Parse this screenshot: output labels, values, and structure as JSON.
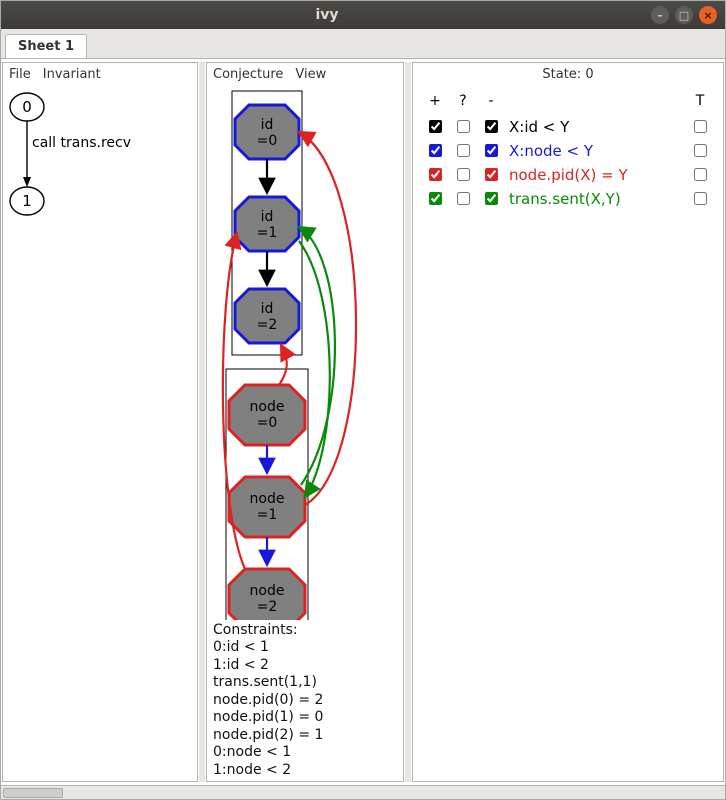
{
  "window": {
    "title": "ivy"
  },
  "tabs": {
    "sheet1": {
      "label": "Sheet 1"
    }
  },
  "left": {
    "menu": {
      "file": "File",
      "invariant": "Invariant"
    },
    "node0": "0",
    "edge_label": "call trans.recv",
    "node1": "1"
  },
  "middle": {
    "menu": {
      "conjecture": "Conjecture",
      "view": "View"
    },
    "ids": [
      {
        "label1": "id",
        "label2": "=0"
      },
      {
        "label1": "id",
        "label2": "=1"
      },
      {
        "label1": "id",
        "label2": "=2"
      }
    ],
    "nodes": [
      {
        "label1": "node",
        "label2": "=0"
      },
      {
        "label1": "node",
        "label2": "=1"
      },
      {
        "label1": "node",
        "label2": "=2"
      }
    ],
    "constraints_header": "Constraints:",
    "constraints": [
      "0:id < 1",
      "1:id < 2",
      "trans.sent(1,1)",
      "node.pid(0) = 2",
      "node.pid(1) = 0",
      "node.pid(2) = 1",
      "0:node < 1",
      "1:node < 2"
    ]
  },
  "right": {
    "state_label": "State: 0",
    "head": {
      "plus": "+",
      "q": "?",
      "minus": "-",
      "T": "T"
    },
    "rows": [
      {
        "cls": "black",
        "plus": true,
        "q": false,
        "minus": true,
        "label": "X:id < Y",
        "t": false
      },
      {
        "cls": "blue",
        "plus": true,
        "q": false,
        "minus": true,
        "label": "X:node < Y",
        "t": false
      },
      {
        "cls": "red",
        "plus": true,
        "q": false,
        "minus": true,
        "label": "node.pid(X) = Y",
        "t": false
      },
      {
        "cls": "green",
        "plus": true,
        "q": false,
        "minus": true,
        "label": "trans.sent(X,Y)",
        "t": false
      }
    ]
  }
}
